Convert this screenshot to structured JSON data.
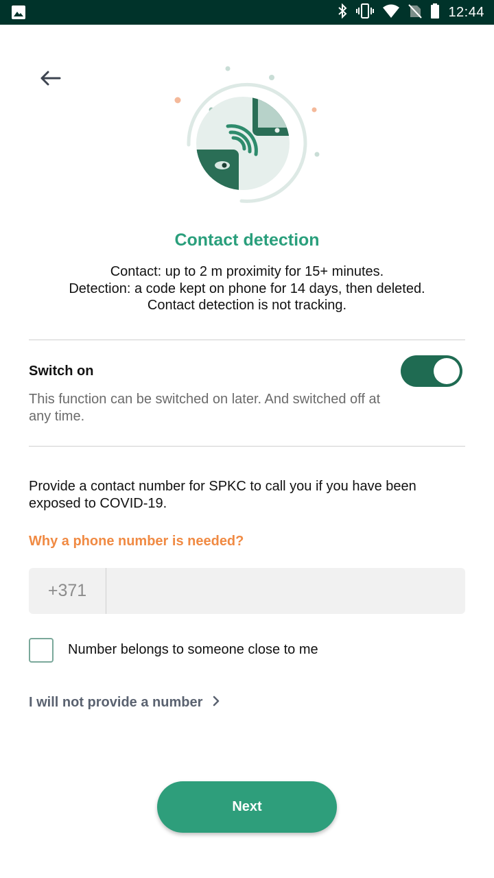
{
  "status_bar": {
    "time": "12:44",
    "icons": [
      "image-icon",
      "bluetooth-icon",
      "vibrate-icon",
      "wifi-icon",
      "no-sim-icon",
      "battery-icon"
    ]
  },
  "colors": {
    "status_bar_bg": "#00332a",
    "accent_green": "#2a9f7c",
    "dark_green": "#1f6b52",
    "link_orange": "#f08a43",
    "button_green": "#2e9e7b"
  },
  "header": {
    "back_icon": "arrow-left-icon",
    "illustration": "contact-detection-illustration"
  },
  "main": {
    "title": "Contact detection",
    "description_lines": [
      "Contact: up to 2 m proximity for 15+ minutes.",
      "Detection: a code kept on phone for 14 days, then deleted.",
      "Contact detection is not tracking."
    ]
  },
  "switch_section": {
    "title": "Switch on",
    "hint": "This function can be switched on later. And switched off at any time.",
    "enabled": true
  },
  "phone_section": {
    "intro": "Provide a contact number for SPKC to call you if you have been exposed to COVID-19.",
    "why_link": "Why a phone number is needed?",
    "country_code": "+371",
    "phone_value": "",
    "checkbox_label": "Number belongs to someone close to me",
    "checkbox_checked": false,
    "skip_label": "I will not provide a number"
  },
  "footer": {
    "next_label": "Next"
  }
}
